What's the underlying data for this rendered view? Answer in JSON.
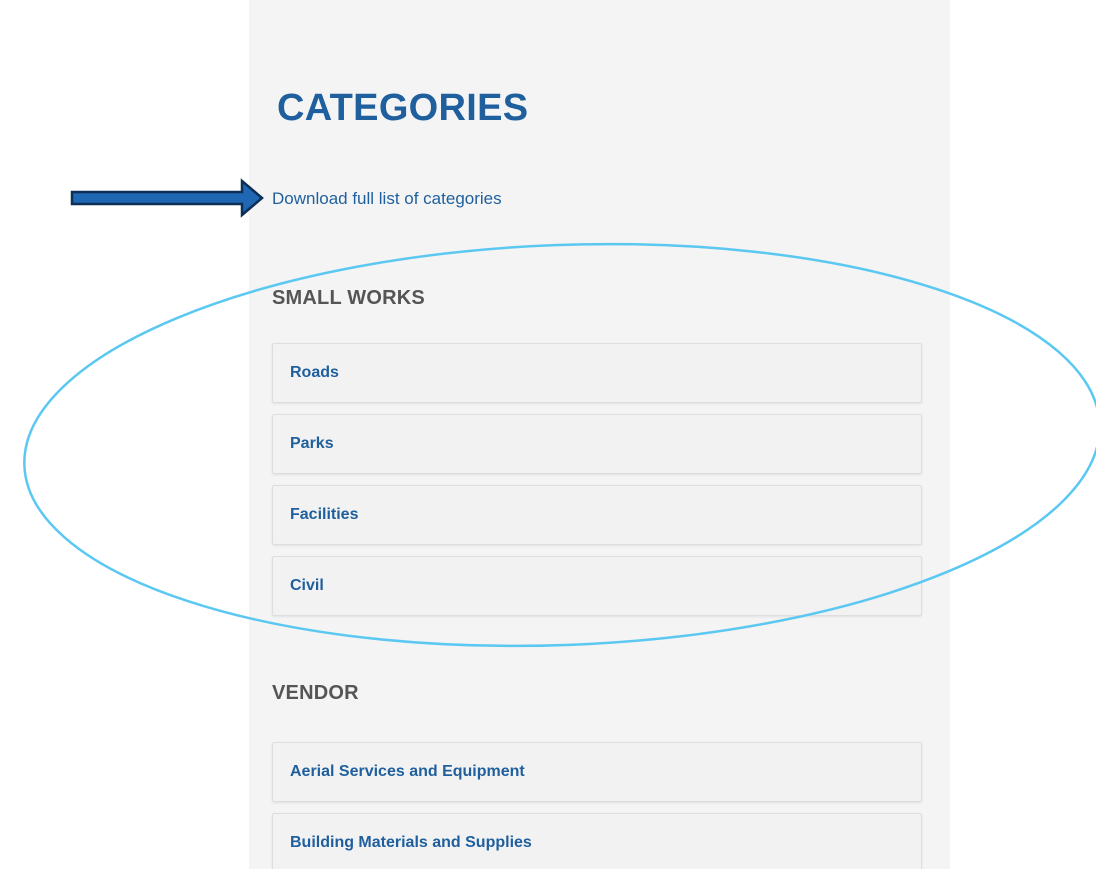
{
  "page": {
    "title": "CATEGORIES",
    "download_link": "Download full list of categories"
  },
  "sections": [
    {
      "title": "SMALL WORKS",
      "items": [
        "Roads",
        "Parks",
        "Facilities",
        "Civil"
      ]
    },
    {
      "title": "VENDOR",
      "items": [
        "Aerial Services and Equipment",
        "Building Materials and Supplies"
      ]
    }
  ],
  "annotations": {
    "arrow_color": "#1f66b3",
    "arrow_outline_color": "#0d2f57",
    "highlight_ellipse_color": "#5bc8f2"
  },
  "colors": {
    "link_blue": "#1f5f9d",
    "section_gray": "#555555",
    "panel_bg": "#f4f4f4"
  }
}
